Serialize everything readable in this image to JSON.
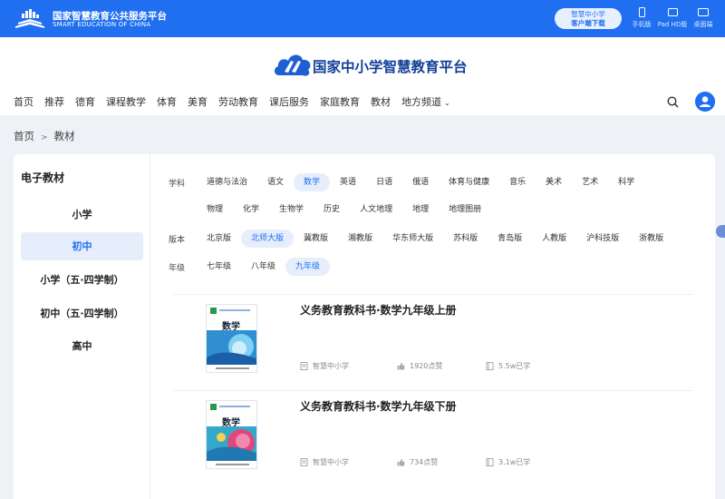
{
  "topbar": {
    "brand_cn": "国家智慧教育公共服务平台",
    "brand_en": "SMART EDUCATION OF CHINA",
    "download_line1": "智慧中小学",
    "download_line2": "客户端下载",
    "devices": [
      "手机版",
      "Pad HD版",
      "桌面端"
    ],
    "icons": [
      "phone-icon",
      "tablet-icon",
      "desktop-icon"
    ]
  },
  "header": {
    "site_title": "国家中小学智慧教育平台",
    "nav": [
      "首页",
      "推荐",
      "德育",
      "课程教学",
      "体育",
      "美育",
      "劳动教育",
      "课后服务",
      "家庭教育",
      "教材",
      "地方频道"
    ]
  },
  "breadcrumb": [
    "首页",
    ">",
    "教材"
  ],
  "sidebar": {
    "title": "电子教材",
    "stages": [
      "小学",
      "初中",
      "小学（五·四学制）",
      "初中（五·四学制）",
      "高中"
    ],
    "active": "初中"
  },
  "filters": {
    "subject_label": "学科",
    "subjects_row1": [
      "道德与法治",
      "语文",
      "数学",
      "英语",
      "日语",
      "俄语",
      "体育与健康",
      "音乐",
      "美术",
      "艺术",
      "科学"
    ],
    "subjects_row2": [
      "物理",
      "化学",
      "生物学",
      "历史",
      "人文地理",
      "地理",
      "地理图册"
    ],
    "selected_subject": "数学",
    "version_label": "版本",
    "versions": [
      "北京版",
      "北师大版",
      "冀教版",
      "湘教版",
      "华东师大版",
      "苏科版",
      "青岛版",
      "人教版",
      "沪科技版",
      "浙教版"
    ],
    "selected_version": "北师大版",
    "grade_label": "年级",
    "grades": [
      "七年级",
      "八年级",
      "九年级"
    ],
    "selected_grade": "九年级"
  },
  "books": [
    {
      "title": "义务教育教科书·数学九年级上册",
      "cover_text": "数学",
      "publisher": "智慧中小学",
      "likes": "1920点赞",
      "learned": "5.5w已学"
    },
    {
      "title": "义务教育教科书·数学九年级下册",
      "cover_text": "数学",
      "publisher": "智慧中小学",
      "likes": "734点赞",
      "learned": "3.1w已学"
    }
  ],
  "colors": {
    "brand_blue": "#1f6ff0",
    "title_navy": "#123f99",
    "selected_bg": "#e6eefc"
  }
}
